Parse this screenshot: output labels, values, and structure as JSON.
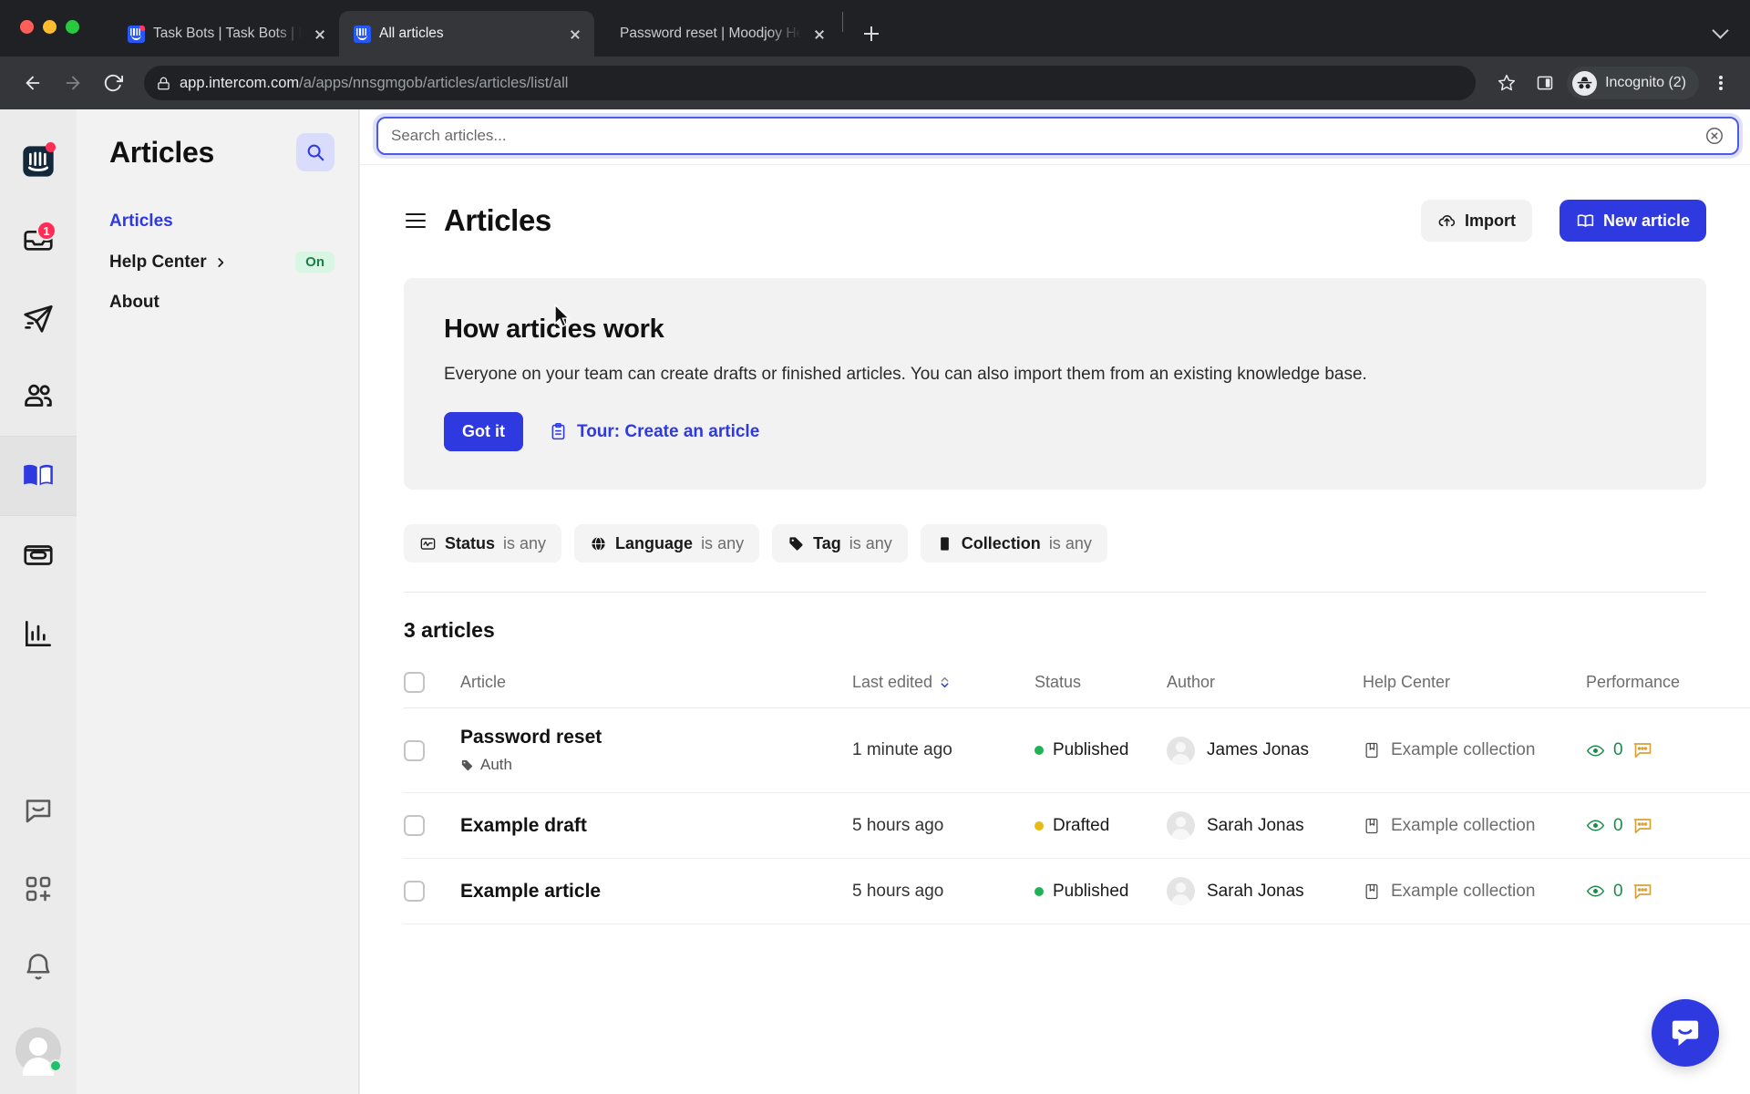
{
  "browser": {
    "tabs": [
      {
        "title": "Task Bots | Task Bots | Moodjoy",
        "active": false,
        "favicon": "intercom-icon",
        "has_badge": true
      },
      {
        "title": "All articles",
        "active": true,
        "favicon": "intercom-icon",
        "has_badge": false
      },
      {
        "title": "Password reset | Moodjoy Help",
        "active": false,
        "favicon": "none",
        "has_badge": false
      }
    ],
    "new_tab_label": "+",
    "url_host": "app.intercom.com",
    "url_path": "/a/apps/nnsgmgob/articles/articles/list/all",
    "profile_label": "Incognito (2)",
    "icons": {
      "back": "arrow-left-icon",
      "forward": "arrow-right-icon",
      "reload": "reload-icon",
      "lock": "lock-icon",
      "bookmark": "star-icon",
      "side_panel": "side-panel-icon",
      "incognito": "incognito-icon",
      "menu": "kebab-menu-icon",
      "tab_list": "chevron-down-icon"
    }
  },
  "rail": {
    "items": [
      {
        "name": "intercom-logo",
        "badge": "",
        "dot": true,
        "selected": false
      },
      {
        "name": "inbox-icon",
        "badge": "1",
        "dot": false,
        "selected": false
      },
      {
        "name": "send-icon",
        "badge": "",
        "dot": false,
        "selected": false
      },
      {
        "name": "contacts-icon",
        "badge": "",
        "dot": false,
        "selected": false
      },
      {
        "name": "articles-book-icon",
        "badge": "",
        "dot": false,
        "selected": true
      },
      {
        "name": "news-icon",
        "badge": "",
        "dot": false,
        "selected": false
      },
      {
        "name": "reports-icon",
        "badge": "",
        "dot": false,
        "selected": false
      }
    ],
    "bottom_items": [
      {
        "name": "messenger-icon"
      },
      {
        "name": "apps-add-icon"
      },
      {
        "name": "bell-icon"
      }
    ],
    "avatar_status": "online"
  },
  "sidebar": {
    "title": "Articles",
    "search_icon": "search-icon",
    "items": [
      {
        "label": "Articles",
        "active": true,
        "chevron": false,
        "badge": ""
      },
      {
        "label": "Help Center",
        "active": false,
        "chevron": true,
        "badge": "On"
      },
      {
        "label": "About",
        "active": false,
        "chevron": false,
        "badge": ""
      }
    ]
  },
  "search": {
    "value": "",
    "placeholder": "Search articles...",
    "clear_icon": "clear-circle-icon"
  },
  "header": {
    "menu_icon": "hamburger-icon",
    "title": "Articles",
    "import_label": "Import",
    "import_icon": "import-cloud-icon",
    "new_article_label": "New article",
    "new_article_icon": "book-icon"
  },
  "banner": {
    "title": "How articles work",
    "text": "Everyone on your team can create drafts or finished articles. You can also import them from an existing knowledge base.",
    "got_it_label": "Got it",
    "tour_label": "Tour: Create an article",
    "tour_icon": "clipboard-icon"
  },
  "filters": [
    {
      "icon": "status-pulse-icon",
      "label": "Status",
      "value": "is any"
    },
    {
      "icon": "globe-icon",
      "label": "Language",
      "value": "is any"
    },
    {
      "icon": "tag-icon",
      "label": "Tag",
      "value": "is any"
    },
    {
      "icon": "collection-book-icon",
      "label": "Collection",
      "value": "is any"
    }
  ],
  "table": {
    "count_label": "3 articles",
    "columns": {
      "article": "Article",
      "last_edited": "Last edited",
      "status": "Status",
      "author": "Author",
      "help_center": "Help Center",
      "performance": "Performance"
    },
    "sort_icon": "sort-chevrons-icon",
    "rows": [
      {
        "title": "Password reset",
        "tag": "Auth",
        "last_edited": "1 minute ago",
        "status": "Published",
        "status_color": "#1fb356",
        "author": "James Jonas",
        "help_center": "Example collection",
        "views": "0"
      },
      {
        "title": "Example draft",
        "tag": "",
        "last_edited": "5 hours ago",
        "status": "Drafted",
        "status_color": "#e8bb14",
        "author": "Sarah Jonas",
        "help_center": "Example collection",
        "views": "0"
      },
      {
        "title": "Example article",
        "tag": "",
        "last_edited": "5 hours ago",
        "status": "Published",
        "status_color": "#1fb356",
        "author": "Sarah Jonas",
        "help_center": "Example collection",
        "views": "0"
      }
    ]
  },
  "launcher": {
    "icon": "intercom-messenger-icon"
  },
  "colors": {
    "accent": "#2f39e0",
    "published": "#1fb356",
    "drafted": "#e8bb14",
    "badge_on_bg": "#d9f5e3",
    "badge_on_text": "#1a7f4b"
  }
}
